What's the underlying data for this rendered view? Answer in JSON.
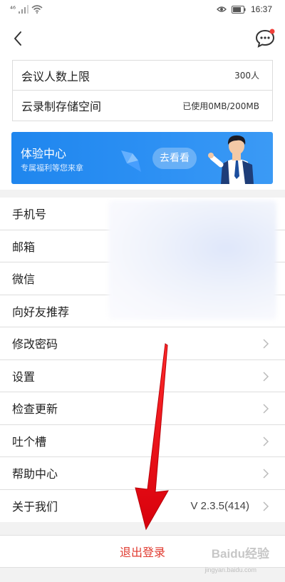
{
  "status_bar": {
    "network": "⁴⁶",
    "time": "16:37",
    "icons": [
      "signal-icon",
      "wifi-icon",
      "eye-icon",
      "battery-icon"
    ]
  },
  "header": {
    "back_icon": "back-arrow-icon",
    "message_icon": "chat-bubble-icon",
    "has_notification_dot": true
  },
  "meeting_info": [
    {
      "label": "会议人数上限",
      "value": "300人"
    },
    {
      "label": "云录制存储空间",
      "value": "已使用0MB/200MB"
    }
  ],
  "banner": {
    "title": "体验中心",
    "subtitle": "专属福利等您来拿",
    "button": "去看看"
  },
  "menu": [
    {
      "label": "手机号",
      "value": "",
      "chevron": false
    },
    {
      "label": "邮箱",
      "value": "",
      "chevron": false
    },
    {
      "label": "微信",
      "value": "",
      "chevron": false
    },
    {
      "label": "向好友推荐",
      "value": "",
      "chevron": false
    },
    {
      "label": "修改密码",
      "value": "",
      "chevron": true
    },
    {
      "label": "设置",
      "value": "",
      "chevron": true
    },
    {
      "label": "检查更新",
      "value": "",
      "chevron": true
    },
    {
      "label": "吐个槽",
      "value": "",
      "chevron": true
    },
    {
      "label": "帮助中心",
      "value": "",
      "chevron": true
    },
    {
      "label": "关于我们",
      "value": "V 2.3.5(414)",
      "chevron": true
    }
  ],
  "logout": {
    "label": "退出登录"
  },
  "watermark": {
    "text": "Baidu经验",
    "sub": "jingyan.baidu.com"
  },
  "colors": {
    "accent_blue": "#2b8ff3",
    "logout_red": "#e03a2f",
    "arrow_red": "#e8141c"
  }
}
